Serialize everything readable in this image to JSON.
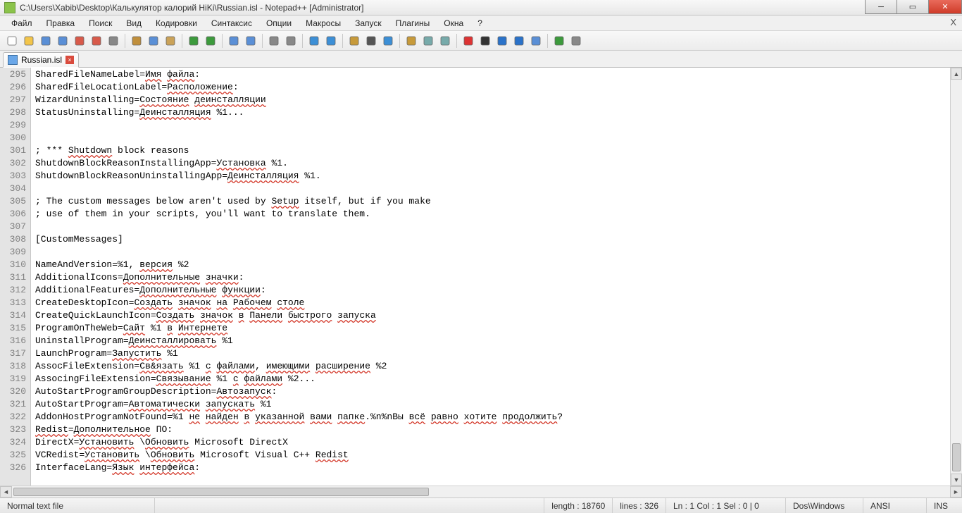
{
  "titlebar": {
    "title": "C:\\Users\\Xabib\\Desktop\\Калькулятор калорий HiKi\\Russian.isl - Notepad++ [Administrator]"
  },
  "menubar": {
    "items": [
      "Файл",
      "Правка",
      "Поиск",
      "Вид",
      "Кодировки",
      "Синтаксис",
      "Опции",
      "Макросы",
      "Запуск",
      "Плагины",
      "Окна",
      "?"
    ]
  },
  "toolbar_icons": [
    "new-file-icon",
    "open-file-icon",
    "save-icon",
    "save-all-icon",
    "close-icon",
    "close-all-icon",
    "print-icon",
    "sep",
    "cut-icon",
    "copy-icon",
    "paste-icon",
    "sep",
    "undo-icon",
    "redo-icon",
    "sep",
    "find-icon",
    "replace-icon",
    "sep",
    "zoom-in-icon",
    "zoom-out-icon",
    "sep",
    "sync-v-icon",
    "sync-h-icon",
    "sep",
    "wordwrap-icon",
    "show-all-chars-icon",
    "indent-guide-icon",
    "sep",
    "folder-as-project-icon",
    "doc-map-icon",
    "function-list-icon",
    "sep",
    "macro-record-icon",
    "macro-stop-icon",
    "macro-play-icon",
    "macro-play-multi-icon",
    "macro-save-icon",
    "sep",
    "spellcheck-icon",
    "spellcheck-lang-icon"
  ],
  "tab": {
    "label": "Russian.isl"
  },
  "editor": {
    "first_line": 295,
    "lines": [
      [
        [
          "SharedFileNameLabel=",
          0
        ],
        [
          "Имя",
          1
        ],
        [
          " ",
          0
        ],
        [
          "файла",
          1
        ],
        [
          ":",
          0
        ]
      ],
      [
        [
          "SharedFileLocationLabel=",
          0
        ],
        [
          "Расположение",
          1
        ],
        [
          ":",
          0
        ]
      ],
      [
        [
          "WizardUninstalling=",
          0
        ],
        [
          "Состояние",
          1
        ],
        [
          " ",
          0
        ],
        [
          "деинсталляции",
          1
        ]
      ],
      [
        [
          "StatusUninstalling=",
          0
        ],
        [
          "Деинсталляция",
          1
        ],
        [
          " %1...",
          0
        ]
      ],
      [
        [
          "",
          0
        ]
      ],
      [
        [
          "",
          0
        ]
      ],
      [
        [
          "; *** ",
          0
        ],
        [
          "Shutdown",
          1
        ],
        [
          " block reasons",
          0
        ]
      ],
      [
        [
          "ShutdownBlockReasonInstallingApp=",
          0
        ],
        [
          "Установка",
          1
        ],
        [
          " %1.",
          0
        ]
      ],
      [
        [
          "ShutdownBlockReasonUninstallingApp=",
          0
        ],
        [
          "Деинсталляция",
          1
        ],
        [
          " %1.",
          0
        ]
      ],
      [
        [
          "",
          0
        ]
      ],
      [
        [
          "; The custom messages below aren't used by ",
          0
        ],
        [
          "Setup",
          1
        ],
        [
          " itself, but if you make",
          0
        ]
      ],
      [
        [
          "; use of them in your scripts, you'll want to translate them.",
          0
        ]
      ],
      [
        [
          "",
          0
        ]
      ],
      [
        [
          "[CustomMessages]",
          0
        ]
      ],
      [
        [
          "",
          0
        ]
      ],
      [
        [
          "NameAndVersion=%1, ",
          0
        ],
        [
          "версия",
          1
        ],
        [
          " %2",
          0
        ]
      ],
      [
        [
          "AdditionalIcons=",
          0
        ],
        [
          "Дополнительные",
          1
        ],
        [
          " ",
          0
        ],
        [
          "значки",
          1
        ],
        [
          ":",
          0
        ]
      ],
      [
        [
          "AdditionalFeatures=",
          0
        ],
        [
          "Дополнительные",
          1
        ],
        [
          " ",
          0
        ],
        [
          "функции",
          1
        ],
        [
          ":",
          0
        ]
      ],
      [
        [
          "CreateDesktopIcon=",
          0
        ],
        [
          "Создать",
          1
        ],
        [
          " ",
          0
        ],
        [
          "значок",
          1
        ],
        [
          " ",
          0
        ],
        [
          "на",
          1
        ],
        [
          " ",
          0
        ],
        [
          "Рабочем",
          1
        ],
        [
          " ",
          0
        ],
        [
          "столе",
          1
        ]
      ],
      [
        [
          "CreateQuickLaunchIcon=",
          0
        ],
        [
          "Создать",
          1
        ],
        [
          " ",
          0
        ],
        [
          "значок",
          1
        ],
        [
          " ",
          0
        ],
        [
          "в",
          1
        ],
        [
          " ",
          0
        ],
        [
          "Панели",
          1
        ],
        [
          " ",
          0
        ],
        [
          "быстрого",
          1
        ],
        [
          " ",
          0
        ],
        [
          "запуска",
          1
        ]
      ],
      [
        [
          "ProgramOnTheWeb=",
          0
        ],
        [
          "Сайт",
          1
        ],
        [
          " %1 ",
          0
        ],
        [
          "в",
          1
        ],
        [
          " ",
          0
        ],
        [
          "Интернете",
          1
        ]
      ],
      [
        [
          "UninstallProgram=",
          0
        ],
        [
          "Деинсталлировать",
          1
        ],
        [
          " %1",
          0
        ]
      ],
      [
        [
          "LaunchProgram=",
          0
        ],
        [
          "Запустить",
          1
        ],
        [
          " %1",
          0
        ]
      ],
      [
        [
          "AssocFileExtension=",
          0
        ],
        [
          "Св&язать",
          1
        ],
        [
          " %1 ",
          0
        ],
        [
          "с",
          1
        ],
        [
          " ",
          0
        ],
        [
          "файлами",
          1
        ],
        [
          ", ",
          0
        ],
        [
          "имеющими",
          1
        ],
        [
          " ",
          0
        ],
        [
          "расширение",
          1
        ],
        [
          " %2",
          0
        ]
      ],
      [
        [
          "AssocingFileExtension=",
          0
        ],
        [
          "Связывание",
          1
        ],
        [
          " %1 ",
          0
        ],
        [
          "с",
          1
        ],
        [
          " ",
          0
        ],
        [
          "файлами",
          1
        ],
        [
          " %2...",
          0
        ]
      ],
      [
        [
          "AutoStartProgramGroupDescription=",
          0
        ],
        [
          "Автозапуск",
          1
        ],
        [
          ":",
          0
        ]
      ],
      [
        [
          "AutoStartProgram=",
          0
        ],
        [
          "Автоматически",
          1
        ],
        [
          " ",
          0
        ],
        [
          "запускать",
          1
        ],
        [
          " %1",
          0
        ]
      ],
      [
        [
          "AddonHostProgramNotFound=%1 ",
          0
        ],
        [
          "не",
          1
        ],
        [
          " ",
          0
        ],
        [
          "найден",
          1
        ],
        [
          " ",
          0
        ],
        [
          "в",
          1
        ],
        [
          " ",
          0
        ],
        [
          "указанной",
          1
        ],
        [
          " ",
          0
        ],
        [
          "вами",
          1
        ],
        [
          " ",
          0
        ],
        [
          "папке",
          1
        ],
        [
          ".%n%nВы ",
          0
        ],
        [
          "всё",
          1
        ],
        [
          " ",
          0
        ],
        [
          "равно",
          1
        ],
        [
          " ",
          0
        ],
        [
          "хотите",
          1
        ],
        [
          " ",
          0
        ],
        [
          "продолжить",
          1
        ],
        [
          "?",
          0
        ]
      ],
      [
        [
          "Redist",
          1
        ],
        [
          "=",
          0
        ],
        [
          "Дополнительное",
          1
        ],
        [
          " ПО:",
          0
        ]
      ],
      [
        [
          "DirectX=",
          0
        ],
        [
          "Установить",
          1
        ],
        [
          " \\",
          0
        ],
        [
          "Обновить",
          1
        ],
        [
          " Microsoft DirectX",
          0
        ]
      ],
      [
        [
          "VCRedist=",
          0
        ],
        [
          "Установить",
          1
        ],
        [
          " \\",
          0
        ],
        [
          "Обновить",
          1
        ],
        [
          " Microsoft Visual C++ ",
          0
        ],
        [
          "Redist",
          1
        ]
      ],
      [
        [
          "InterfaceLang=",
          0
        ],
        [
          "Язык",
          1
        ],
        [
          " ",
          0
        ],
        [
          "интерфейса",
          1
        ],
        [
          ":",
          0
        ]
      ]
    ]
  },
  "statusbar": {
    "file_type": "Normal text file",
    "length_label": "length : 18760",
    "lines_label": "lines : 326",
    "pos_label": "Ln : 1   Col : 1   Sel : 0 | 0",
    "eol": "Dos\\Windows",
    "enc": "ANSI",
    "ins": "INS"
  }
}
